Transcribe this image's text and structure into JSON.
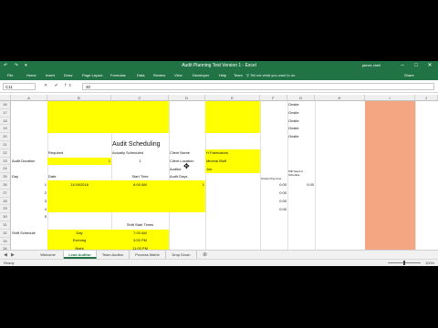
{
  "window": {
    "title": "Audit Planning Test Version 1 - Excel",
    "user": "james chell",
    "quick_access": "↶ ↷ ▾"
  },
  "ribbon_tabs": [
    "File",
    "Home",
    "Insert",
    "Draw",
    "Page Layout",
    "Formulas",
    "Data",
    "Review",
    "View",
    "Developer",
    "Help",
    "Team"
  ],
  "tell_me": "Tell me what you want to do",
  "share_label": "Share",
  "formula_bar": {
    "name_box": "C11",
    "value": "30",
    "fx": "✕ ✔ fx"
  },
  "columns": [
    "A",
    "B",
    "C",
    "D",
    "E",
    "F",
    "G",
    "H",
    "I",
    "J"
  ],
  "rows": [
    "16",
    "17",
    "18",
    "19",
    "20",
    "21",
    "22",
    "23",
    "24",
    "25",
    "26",
    "27",
    "28",
    "29",
    "30",
    "31",
    "32",
    "33",
    "34",
    "35"
  ],
  "cells": {
    "title": "Audit Scheduling",
    "required": "Required",
    "actually_scheduled": "Actually Scheduled",
    "client_name": "Client Name",
    "client_name_value": "H Fabricators",
    "client_location": "Client Location",
    "client_location_value": "Mineral Bluff",
    "auditor": "Auditor",
    "auditor_value": "Joe",
    "audit_duration": "Audit Duration",
    "audit_duration_required": "1",
    "audit_duration_actual": "1",
    "day": "Day",
    "date": "Date",
    "start_time": "Start Time",
    "audit_days": "Audit Days",
    "onsite_prep": "Onsite Prep time",
    "still_need": "Still Need to Schedule",
    "day_numbers": [
      "1",
      "2",
      "3",
      "4",
      "5"
    ],
    "date_1": "11/18/2018",
    "start_1": "8:00 AM",
    "audit_days_1": "1",
    "prep_values": [
      "0.00",
      "0.00",
      "0.00",
      "0.00"
    ],
    "still_need_1": "0.00",
    "shift_start_time": "Shift Start Times",
    "shift_schedule": "Shift Schedule",
    "shifts": [
      {
        "name": "Day",
        "time": "7:00 AM"
      },
      {
        "name": "Evening",
        "time": "3:00 PM"
      },
      {
        "name": "Night",
        "time": "11:00 PM"
      }
    ],
    "onsite": [
      "Onsite",
      "Onsite",
      "Onsite",
      "Onsite",
      "Onsite"
    ]
  },
  "sheet_tabs": [
    "Welcome",
    "Lead Auditor",
    "Team Auditor",
    "Process Matrix",
    "Drop Down"
  ],
  "active_sheet": "Lead Auditor",
  "status": {
    "ready": "Ready",
    "zoom": "100%"
  },
  "colors": {
    "excel_green": "#217346",
    "highlight_yellow": "#ffff00",
    "salmon": "#f4a582"
  }
}
